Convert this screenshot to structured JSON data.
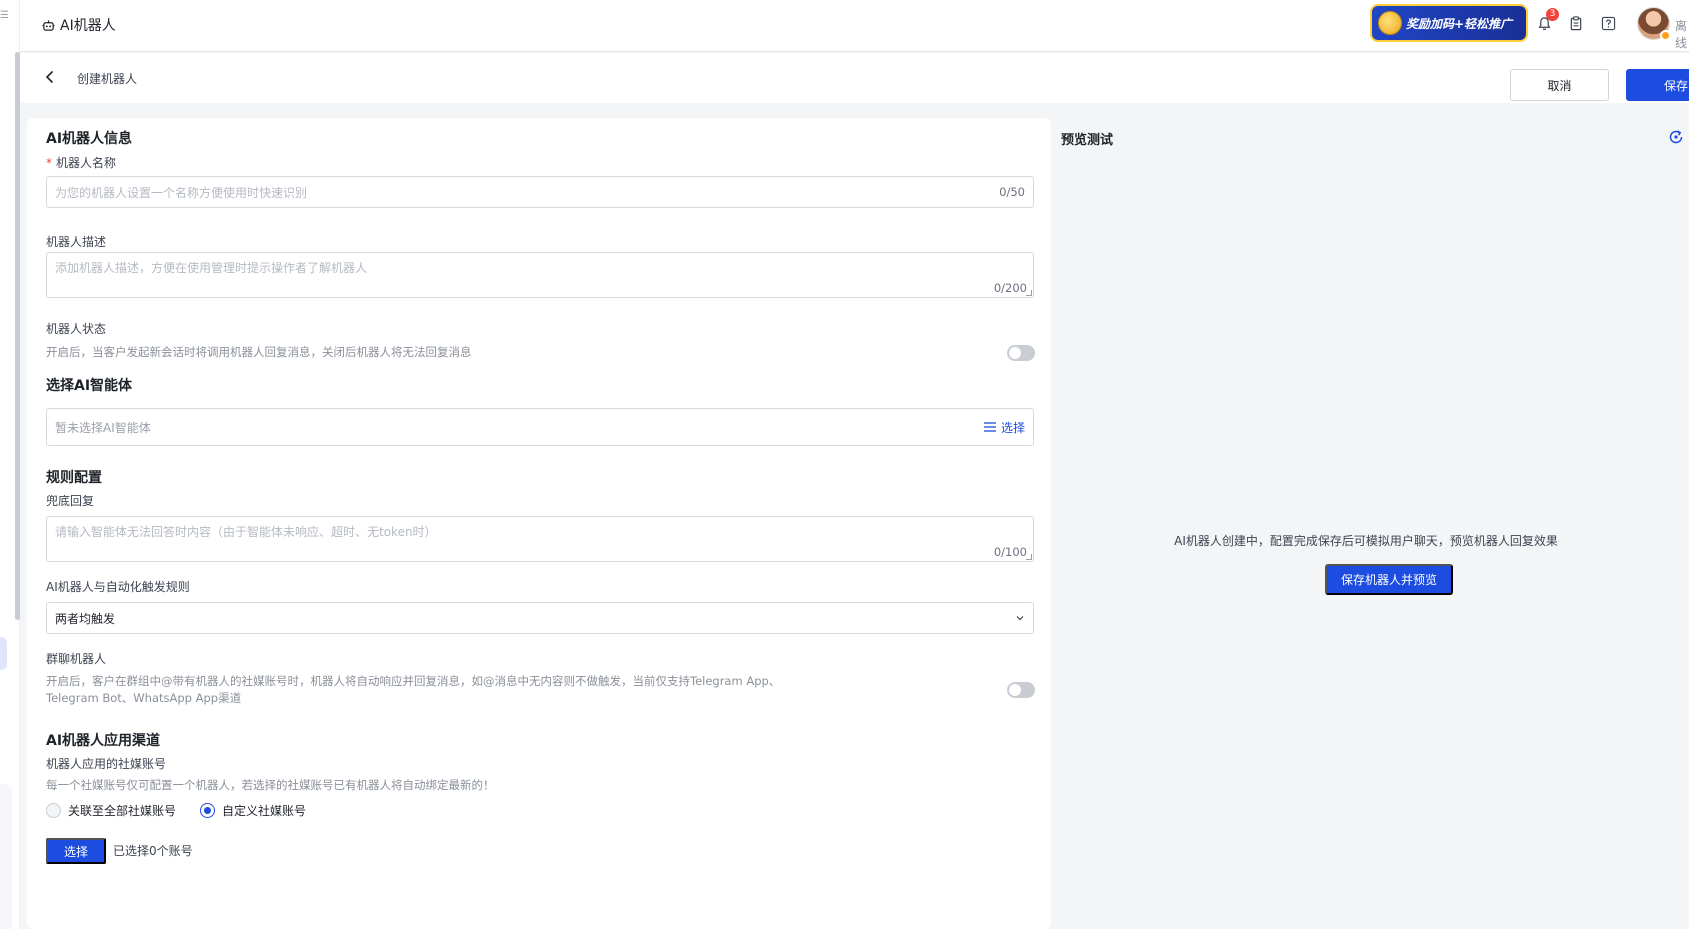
{
  "topbar": {
    "app_title": "AI机器人",
    "promo_text": "奖励加码+轻松推广",
    "notification_count": "3",
    "user_status": "离线"
  },
  "header": {
    "title": "创建机器人",
    "cancel_label": "取消",
    "save_label": "保存"
  },
  "form": {
    "info_section": "AI机器人信息",
    "name_label": "机器人名称",
    "name_placeholder": "为您的机器人设置一个名称方便使用时快速识别",
    "name_counter": "0/50",
    "desc_label": "机器人描述",
    "desc_placeholder": "添加机器人描述，方便在使用管理时提示操作者了解机器人",
    "desc_counter": "0/200",
    "status_label": "机器人状态",
    "status_hint": "开启后，当客户发起新会话时将调用机器人回复消息，关闭后机器人将无法回复消息",
    "status_enabled": false,
    "agent_section": "选择AI智能体",
    "agent_placeholder": "暂未选择AI智能体",
    "agent_choose": "选择",
    "rules_section": "规则配置",
    "fallback_label": "兜底回复",
    "fallback_placeholder": "请输入智能体无法回答时内容（由于智能体未响应、超时、无token时）",
    "fallback_counter": "0/100",
    "trigger_label": "AI机器人与自动化触发规则",
    "trigger_value": "两者均触发",
    "group_label": "群聊机器人",
    "group_hint_1": "开启后，客户在群组中@带有机器人的社媒账号时，机器人将自动响应并回复消息，如@消息中无内容则不做触发，当前仅支持Telegram App、",
    "group_hint_2": "Telegram Bot、WhatsApp App渠道",
    "group_enabled": false,
    "channel_section": "AI机器人应用渠道",
    "account_label": "机器人应用的社媒账号",
    "account_hint": "每一个社媒账号仅可配置一个机器人，若选择的社媒账号已有机器人将自动绑定最新的！",
    "radio_all": "关联至全部社媒账号",
    "radio_custom": "自定义社媒账号",
    "radio_selected": "custom",
    "select_button": "选择",
    "selected_count": "已选择0个账号"
  },
  "preview": {
    "title": "预览测试",
    "empty_text": "AI机器人创建中，配置完成保存后可模拟用户聊天，预览机器人回复效果",
    "save_preview_button": "保存机器人并预览"
  },
  "colors": {
    "primary": "#1d4de0",
    "danger": "#f04438",
    "toggle_off": "#c9cdd3"
  }
}
